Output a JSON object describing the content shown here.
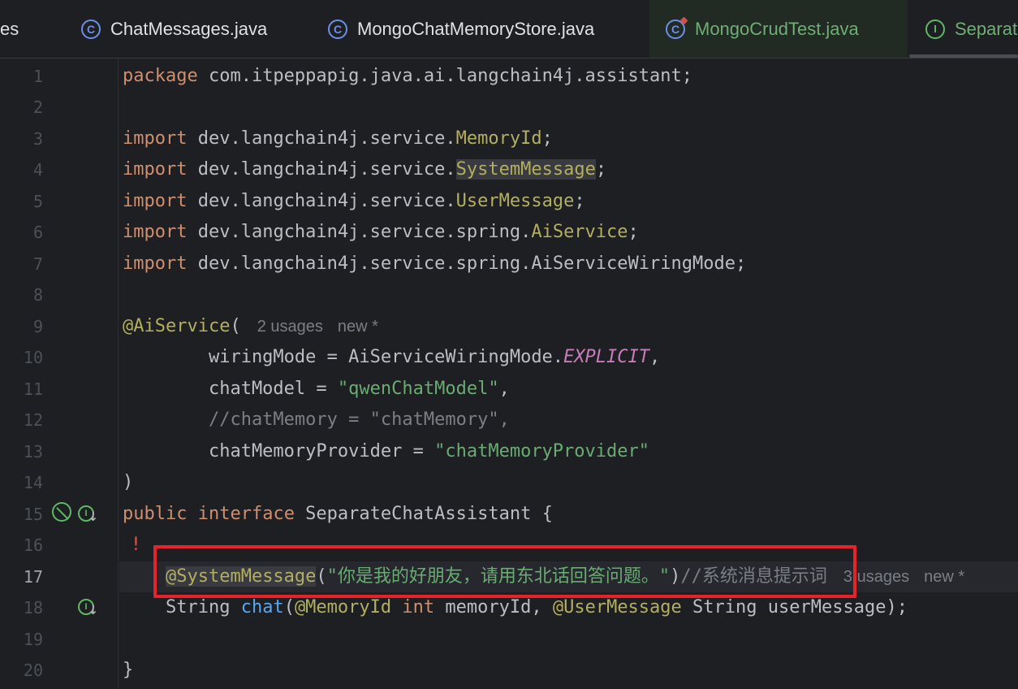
{
  "tabs": [
    {
      "label": "es",
      "icon": "none"
    },
    {
      "label": "ChatMessages.java",
      "icon": "class-icon"
    },
    {
      "label": "MongoChatMemoryStore.java",
      "icon": "class-icon"
    },
    {
      "label": "MongoCrudTest.java",
      "icon": "test-class-icon"
    },
    {
      "label": "Separat",
      "icon": "interface-icon"
    }
  ],
  "gutter": {
    "line_numbers": [
      "1",
      "2",
      "3",
      "4",
      "5",
      "6",
      "7",
      "8",
      "9",
      "10",
      "11",
      "12",
      "13",
      "14",
      "15",
      "16",
      "17",
      "18",
      "19",
      "20"
    ]
  },
  "code": {
    "l1_kw": "package",
    "l1_rest": " com.itpeppapig.java.ai.langchain4j.assistant;",
    "l3_kw": "import",
    "l3_pkg": " dev.langchain4j.service.",
    "l3_cls": "MemoryId",
    "l3_end": ";",
    "l4_kw": "import",
    "l4_pkg": " dev.langchain4j.service.",
    "l4_cls": "SystemMessage",
    "l4_end": ";",
    "l5_kw": "import",
    "l5_pkg": " dev.langchain4j.service.",
    "l5_cls": "UserMessage",
    "l5_end": ";",
    "l6_kw": "import",
    "l6_pkg": " dev.langchain4j.service.spring.",
    "l6_cls": "AiService",
    "l6_end": ";",
    "l7_kw": "import",
    "l7_rest": " dev.langchain4j.service.spring.AiServiceWiringMode;",
    "l9_ann": "@AiService",
    "l9_paren": "(",
    "l9_hint_usages": "2 usages",
    "l9_hint_new": "new *",
    "l10_a": "        wiringMode = AiServiceWiringMode.",
    "l10_const": "EXPLICIT",
    "l10_end": ",",
    "l11_a": "        chatModel = ",
    "l11_str": "\"qwenChatModel\"",
    "l11_end": ",",
    "l12_cmt": "        //chatMemory = \"chatMemory\",",
    "l13_a": "        chatMemoryProvider = ",
    "l13_str": "\"chatMemoryProvider\"",
    "l14": ")",
    "l15_kw1": "public",
    "l15_kw2": " interface",
    "l15_rest": " SeparateChatAssistant {",
    "l17_indent": "    ",
    "l17_ann": "@SystemMessage",
    "l17_p1": "(",
    "l17_str": "\"你是我的好朋友，请用东北话回答问题。\"",
    "l17_p2": ")",
    "l17_cmt": "//系统消息提示词",
    "l17_hint_usages": "3 usages",
    "l17_hint_new": "new *",
    "l18_a": "    String ",
    "l18_fn": "chat",
    "l18_p": "(",
    "l18_ann1": "@MemoryId",
    "l18_kw": " int",
    "l18_b": " memoryId, ",
    "l18_ann2": "@UserMessage",
    "l18_c": " String userMessage);",
    "l20": "}"
  },
  "colors": {
    "background": "#1e1f22",
    "keyword": "#cf8e6d",
    "annotation": "#b3ae60",
    "string": "#6aab73",
    "comment": "#7a7e85",
    "constant": "#c77dbb",
    "method": "#56a8f5",
    "highlight_box": "#e8222a"
  }
}
